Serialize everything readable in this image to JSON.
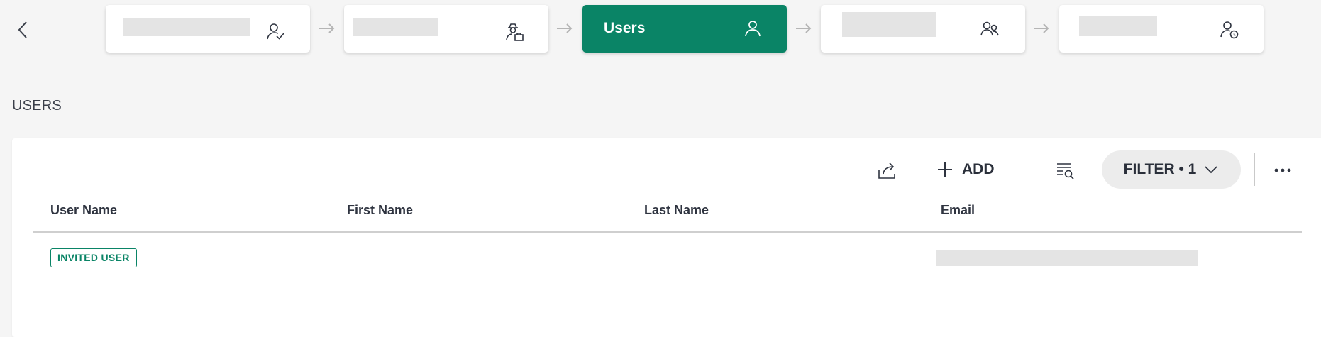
{
  "stepper": {
    "active_label": "Users",
    "arrow_color": "#b5b5b5",
    "active_color": "#0a8466"
  },
  "icons": {
    "back": "chevron-left-icon",
    "step1": "user-check-icon",
    "step2": "user-incognito-briefcase-icon",
    "step3": "user-icon",
    "step4": "users-group-icon",
    "step5": "user-clock-icon",
    "export": "share-export-icon",
    "add": "plus-icon",
    "search_list": "list-search-icon",
    "filter_chevron": "chevron-down-icon",
    "more": "more-horizontal-icon"
  },
  "section": {
    "title": "USERS"
  },
  "toolbar": {
    "add_label": "ADD",
    "filter_label": "FILTER • 1"
  },
  "table": {
    "columns": [
      "User Name",
      "First Name",
      "Last Name",
      "Email"
    ],
    "rows": [
      {
        "user_name_badge": "INVITED USER",
        "first_name": "",
        "last_name": "",
        "email": ""
      }
    ]
  }
}
